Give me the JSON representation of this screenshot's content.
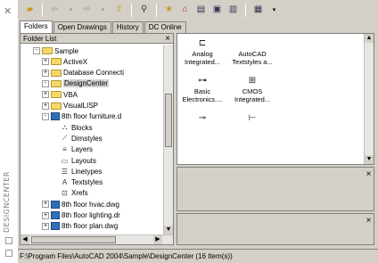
{
  "palette": {
    "title": "DESIGNCENTER",
    "close_icon": "close-icon"
  },
  "toolbar": {
    "buttons": [
      "load-icon",
      "back-icon",
      "forward-icon",
      "up-icon",
      "search-icon",
      "favorites-icon",
      "home-icon",
      "tree-view-icon",
      "preview-icon",
      "description-icon",
      "views-icon"
    ]
  },
  "tabs": [
    "Folders",
    "Open Drawings",
    "History",
    "DC Online"
  ],
  "tree": {
    "header": "Folder List",
    "items": [
      {
        "label": "Sample",
        "depth": 0,
        "expander": "-",
        "icon": "folder"
      },
      {
        "label": "ActiveX",
        "depth": 1,
        "expander": "+",
        "icon": "folder"
      },
      {
        "label": "Database Connecti",
        "depth": 1,
        "expander": "+",
        "icon": "folder"
      },
      {
        "label": "DesignCenter",
        "depth": 1,
        "expander": "-",
        "icon": "folder",
        "selected": true
      },
      {
        "label": "VBA",
        "depth": 1,
        "expander": "+",
        "icon": "folder"
      },
      {
        "label": "VisualLISP",
        "depth": 1,
        "expander": "+",
        "icon": "folder"
      },
      {
        "label": "8th floor furniture.d",
        "depth": 1,
        "expander": "-",
        "icon": "drawing"
      },
      {
        "label": "Blocks",
        "depth": 2,
        "expander": "",
        "icon": "node"
      },
      {
        "label": "Dimstyles",
        "depth": 2,
        "expander": "",
        "icon": "node"
      },
      {
        "label": "Layers",
        "depth": 2,
        "expander": "",
        "icon": "node"
      },
      {
        "label": "Layouts",
        "depth": 2,
        "expander": "",
        "icon": "node"
      },
      {
        "label": "Linetypes",
        "depth": 2,
        "expander": "",
        "icon": "node"
      },
      {
        "label": "Textstyles",
        "depth": 2,
        "expander": "",
        "icon": "node"
      },
      {
        "label": "Xrefs",
        "depth": 2,
        "expander": "",
        "icon": "node"
      },
      {
        "label": "8th floor hvac.dwg",
        "depth": 1,
        "expander": "+",
        "icon": "drawing"
      },
      {
        "label": "8th floor lighting.dr",
        "depth": 1,
        "expander": "+",
        "icon": "drawing"
      },
      {
        "label": "8th floor plan.dwg",
        "depth": 1,
        "expander": "+",
        "icon": "drawing"
      }
    ]
  },
  "content": {
    "items": [
      {
        "label": "Analog Integrated...",
        "glyph": "⊏"
      },
      {
        "label": "AutoCAD Textstyles a...",
        "glyph": ""
      },
      {
        "label": "Basic Electronics....",
        "glyph": "⊶"
      },
      {
        "label": "CMOS Integrated...",
        "glyph": "⊞"
      },
      {
        "label": "",
        "glyph": "⊸"
      },
      {
        "label": "",
        "glyph": "⊢"
      }
    ]
  },
  "status": {
    "path": "F:\\Program Files\\AutoCAD 2004\\Sample\\DesignCenter (16 Item(s))"
  },
  "colors": {
    "chrome": "#d4d0c8",
    "folder": "#f4d86a",
    "drawing": "#2f6fb8"
  }
}
